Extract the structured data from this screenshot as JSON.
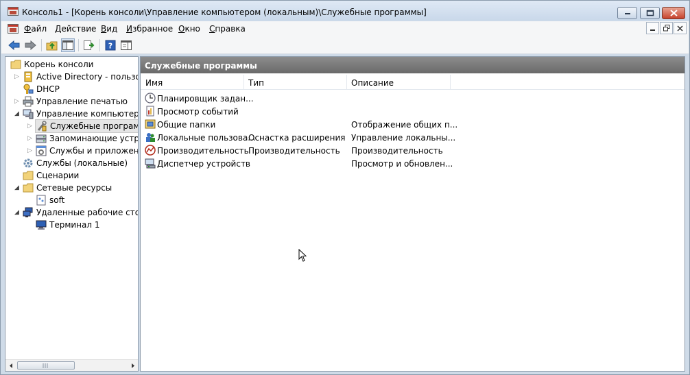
{
  "window": {
    "title": "Консоль1 - [Корень консоли\\Управление компьютером (локальным)\\Служебные программы]"
  },
  "menubar": {
    "items": [
      {
        "label": "Файл",
        "u": "Ф",
        "rest": "айл"
      },
      {
        "label": "Действие",
        "u": "Д",
        "rest": "ействие"
      },
      {
        "label": "Вид",
        "u": "В",
        "rest": "ид"
      },
      {
        "label": "Избранное",
        "u": "И",
        "rest": "збранное"
      },
      {
        "label": "Окно",
        "u": "О",
        "rest": "кно"
      },
      {
        "label": "Справка",
        "u": "С",
        "rest": "правка"
      }
    ]
  },
  "toolbar": {
    "buttons": [
      "back-icon",
      "forward-icon",
      "up-folder-icon",
      "show-hide-tree-icon",
      "export-list-icon",
      "help-icon",
      "show-action-pane-icon"
    ]
  },
  "tree": {
    "items": [
      {
        "label": "Корень консоли",
        "icon": "folder-icon"
      },
      {
        "label": "Active Directory - пользова",
        "icon": "ad-icon"
      },
      {
        "label": "DHCP",
        "icon": "dhcp-icon"
      },
      {
        "label": "Управление печатью",
        "icon": "printer-icon"
      },
      {
        "label": "Управление компьютером",
        "icon": "computer-management-icon"
      },
      {
        "label": "Служебные программ",
        "icon": "tools-icon"
      },
      {
        "label": "Запоминающие устро",
        "icon": "storage-icon"
      },
      {
        "label": "Службы и приложени",
        "icon": "services-apps-icon"
      },
      {
        "label": "Службы (локальные)",
        "icon": "gear-icon"
      },
      {
        "label": "Сценарии",
        "icon": "folder-icon"
      },
      {
        "label": "Сетевые ресурсы",
        "icon": "folder-icon"
      },
      {
        "label": "soft",
        "icon": "share-icon"
      },
      {
        "label": "Удаленные рабочие столь",
        "icon": "remote-desktops-icon"
      },
      {
        "label": "Терминал 1",
        "icon": "terminal-icon"
      }
    ]
  },
  "content": {
    "panel_title": "Служебные программы",
    "columns": [
      "Имя",
      "Тип",
      "Описание"
    ],
    "rows": [
      {
        "name": "Планировщик задан...",
        "type": "",
        "desc": "",
        "icon": "clock-icon"
      },
      {
        "name": "Просмотр событий",
        "type": "",
        "desc": "",
        "icon": "event-viewer-icon"
      },
      {
        "name": "Общие папки",
        "type": "",
        "desc": "Отображение общих п...",
        "icon": "shared-folders-icon"
      },
      {
        "name": "Локальные пользова...",
        "type": "Оснастка расширения",
        "desc": "Управление локальны...",
        "icon": "users-icon"
      },
      {
        "name": "Производительность",
        "type": "Производительность",
        "desc": "Производительность",
        "icon": "performance-icon"
      },
      {
        "name": "Диспетчер устройств",
        "type": "",
        "desc": "Просмотр и обновлен...",
        "icon": "device-manager-icon"
      }
    ]
  }
}
